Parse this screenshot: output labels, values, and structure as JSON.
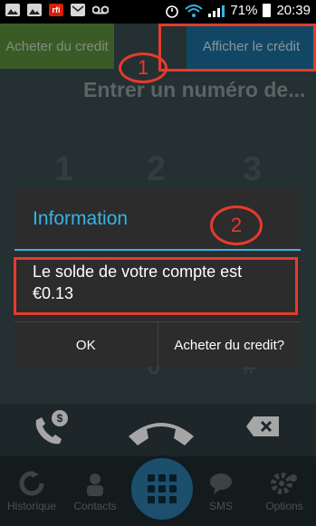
{
  "status_bar": {
    "battery": "71%",
    "time": "20:39",
    "notification_icons": [
      "image-icon",
      "image-icon",
      "rfi-icon",
      "mail-icon",
      "voicemail-icon"
    ],
    "rfi_label": "rfi",
    "system_icons": [
      "alarm-icon",
      "wifi-icon",
      "signal-icon",
      "battery-icon"
    ]
  },
  "header": {
    "buy_credit": "Acheter du credit",
    "show_credit": "Afficher le crédit"
  },
  "dialer": {
    "entry_placeholder": "Entrer un numéro de...",
    "visible_digits": [
      "1",
      "2",
      "3",
      "*",
      "0",
      "#"
    ]
  },
  "dialog": {
    "title": "Information",
    "message": "Le solde de votre compte est €0.13",
    "ok_button": "OK",
    "buy_button": "Acheter du credit?"
  },
  "annotations": {
    "marker_1": "1",
    "marker_2": "2",
    "color": "#e53b2c"
  },
  "tabs": [
    {
      "label": "Historique",
      "icon": "history-icon"
    },
    {
      "label": "Contacts",
      "icon": "contacts-icon"
    },
    {
      "label": "SMS",
      "icon": "sms-icon"
    },
    {
      "label": "Options",
      "icon": "gear-icon"
    }
  ],
  "colors": {
    "accent": "#35b4e5",
    "buy_green": "#5a8c3a",
    "show_blue": "#1b6e9b",
    "dialog_bg": "#2c2c2c"
  }
}
